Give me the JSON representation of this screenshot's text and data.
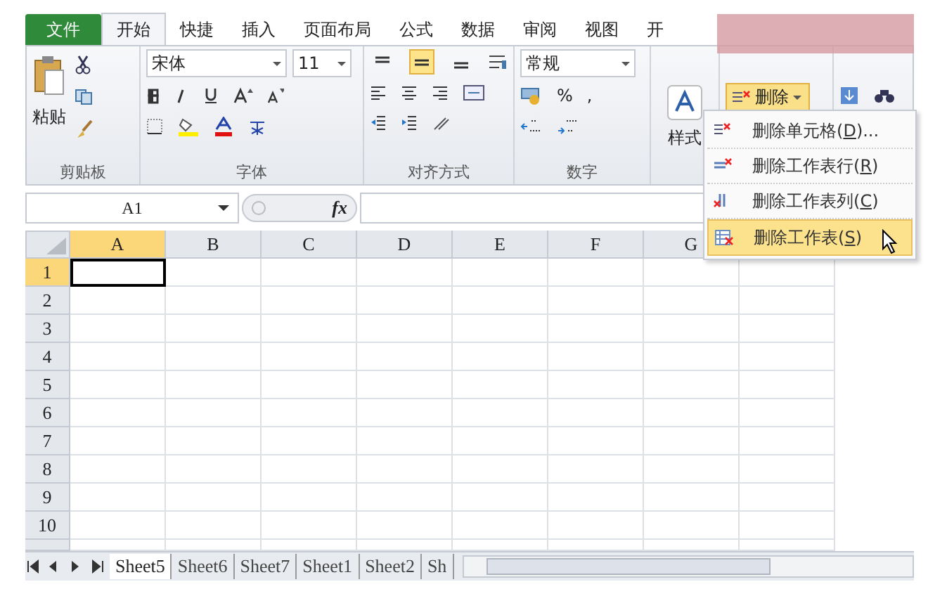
{
  "tabs": [
    {
      "label": "文件",
      "kind": "file",
      "selected": false
    },
    {
      "label": "开始",
      "kind": "tab",
      "selected": true
    },
    {
      "label": "快捷",
      "kind": "tab",
      "selected": false
    },
    {
      "label": "插入",
      "kind": "tab",
      "selected": false
    },
    {
      "label": "页面布局",
      "kind": "tab",
      "selected": false
    },
    {
      "label": "公式",
      "kind": "tab",
      "selected": false
    },
    {
      "label": "数据",
      "kind": "tab",
      "selected": false
    },
    {
      "label": "审阅",
      "kind": "tab",
      "selected": false
    },
    {
      "label": "视图",
      "kind": "tab",
      "selected": false
    },
    {
      "label": "开",
      "kind": "tab",
      "selected": false
    }
  ],
  "ribbon": {
    "paste": "粘贴",
    "clipboard_group": "剪贴板",
    "font_name": "宋体",
    "font_size": "11",
    "font_group": "字体",
    "vertical_align": [
      {
        "selected": false
      },
      {
        "selected": true
      },
      {
        "selected": false
      }
    ],
    "alignment_group": "对齐方式",
    "number_format": "常规",
    "percent": "%",
    "comma": ",",
    "number_group": "数字",
    "styles": "样式",
    "delete": "删除"
  },
  "name_box": "A1",
  "fx": "fx",
  "columns": [
    {
      "label": "A",
      "selected": true
    },
    {
      "label": "B",
      "selected": false
    },
    {
      "label": "C",
      "selected": false
    },
    {
      "label": "D",
      "selected": false
    },
    {
      "label": "E",
      "selected": false
    },
    {
      "label": "F",
      "selected": false
    },
    {
      "label": "G",
      "selected": false
    }
  ],
  "rows": [
    {
      "label": "1",
      "selected": true
    },
    {
      "label": "2",
      "selected": false
    },
    {
      "label": "3",
      "selected": false
    },
    {
      "label": "4",
      "selected": false
    },
    {
      "label": "5",
      "selected": false
    },
    {
      "label": "6",
      "selected": false
    },
    {
      "label": "7",
      "selected": false
    },
    {
      "label": "8",
      "selected": false
    },
    {
      "label": "9",
      "selected": false
    },
    {
      "label": "10",
      "selected": false
    }
  ],
  "menu": [
    {
      "kind": "cells",
      "label": "删除单元格(",
      "key": "D",
      "suffix": ")...",
      "selected": false
    },
    {
      "kind": "rows",
      "label": "删除工作表行(",
      "key": "R",
      "suffix": ")",
      "selected": false
    },
    {
      "kind": "cols",
      "label": "删除工作表列(",
      "key": "C",
      "suffix": ")",
      "selected": false
    },
    {
      "kind": "sheet",
      "label": "删除工作表(",
      "key": "S",
      "suffix": ")",
      "selected": true
    }
  ],
  "sheet_tabs": [
    {
      "label": "Sheet5",
      "selected": true
    },
    {
      "label": "Sheet6",
      "selected": false
    },
    {
      "label": "Sheet7",
      "selected": false
    },
    {
      "label": "Sheet1",
      "selected": false
    },
    {
      "label": "Sheet2",
      "selected": false
    },
    {
      "label": "Sh",
      "selected": false
    }
  ]
}
